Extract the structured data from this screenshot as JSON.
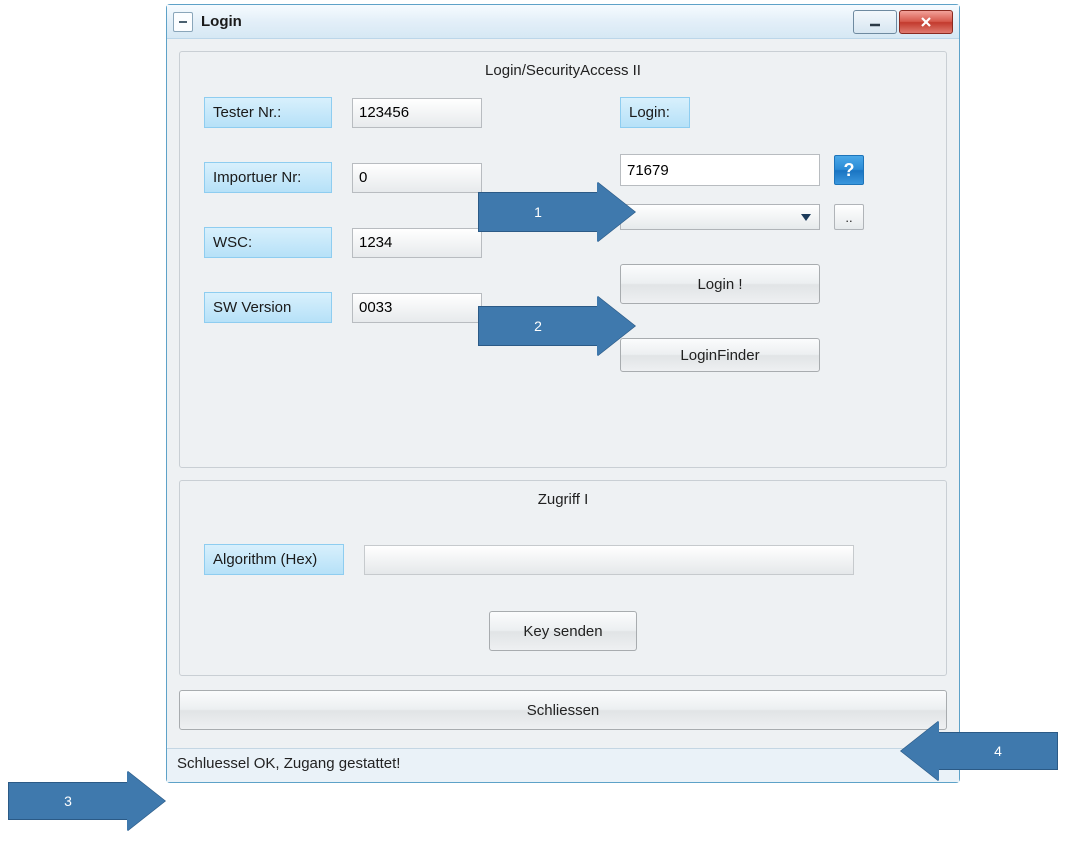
{
  "window": {
    "title": "Login",
    "sysicon": "minimize-restore-icon"
  },
  "group1": {
    "title": "Login/SecurityAccess II",
    "left": {
      "tester_label": "Tester Nr.:",
      "tester_value": "123456",
      "importer_label": "Importuer Nr:",
      "importer_value": "0",
      "wsc_label": "WSC:",
      "wsc_value": "1234",
      "swver_label": "SW Version",
      "swver_value": "0033"
    },
    "right": {
      "login_label": "Login:",
      "login_value": "71679",
      "help_label": "?",
      "more_label": "..",
      "login_btn": "Login !",
      "loginfinder_btn": "LoginFinder"
    }
  },
  "group2": {
    "title": "Zugriff I",
    "alg_label": "Algorithm (Hex)",
    "alg_value": "",
    "key_btn": "Key senden"
  },
  "close_btn": "Schliessen",
  "status": "Schluessel OK, Zugang gestattet!",
  "callouts": {
    "c1": "1",
    "c2": "2",
    "c3": "3",
    "c4": "4"
  }
}
